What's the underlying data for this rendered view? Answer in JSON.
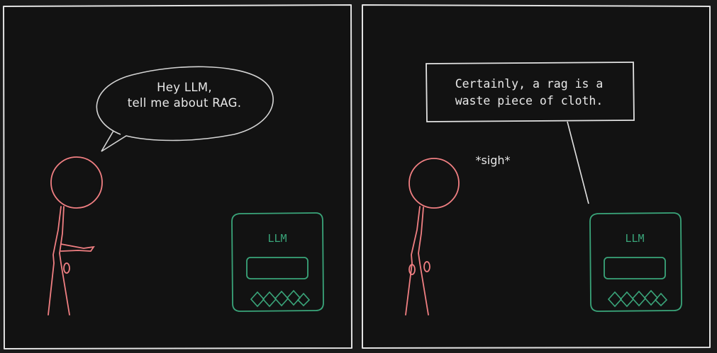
{
  "panel1": {
    "speech_text": [
      "Hey LLM,",
      "tell me about RAG."
    ],
    "device_label": "LLM"
  },
  "panel2": {
    "sigh_text": "*sigh*",
    "caption_text": [
      "Certainly, a rag is a",
      "waste piece of cloth."
    ],
    "device_label": "LLM"
  },
  "colors": {
    "background": "#1a1a1a",
    "panel_fill": "#121212",
    "panel_border": "#e2e2e2",
    "figure": "#f07f82",
    "device": "#3aa57a",
    "text": "#e8e8e8"
  }
}
